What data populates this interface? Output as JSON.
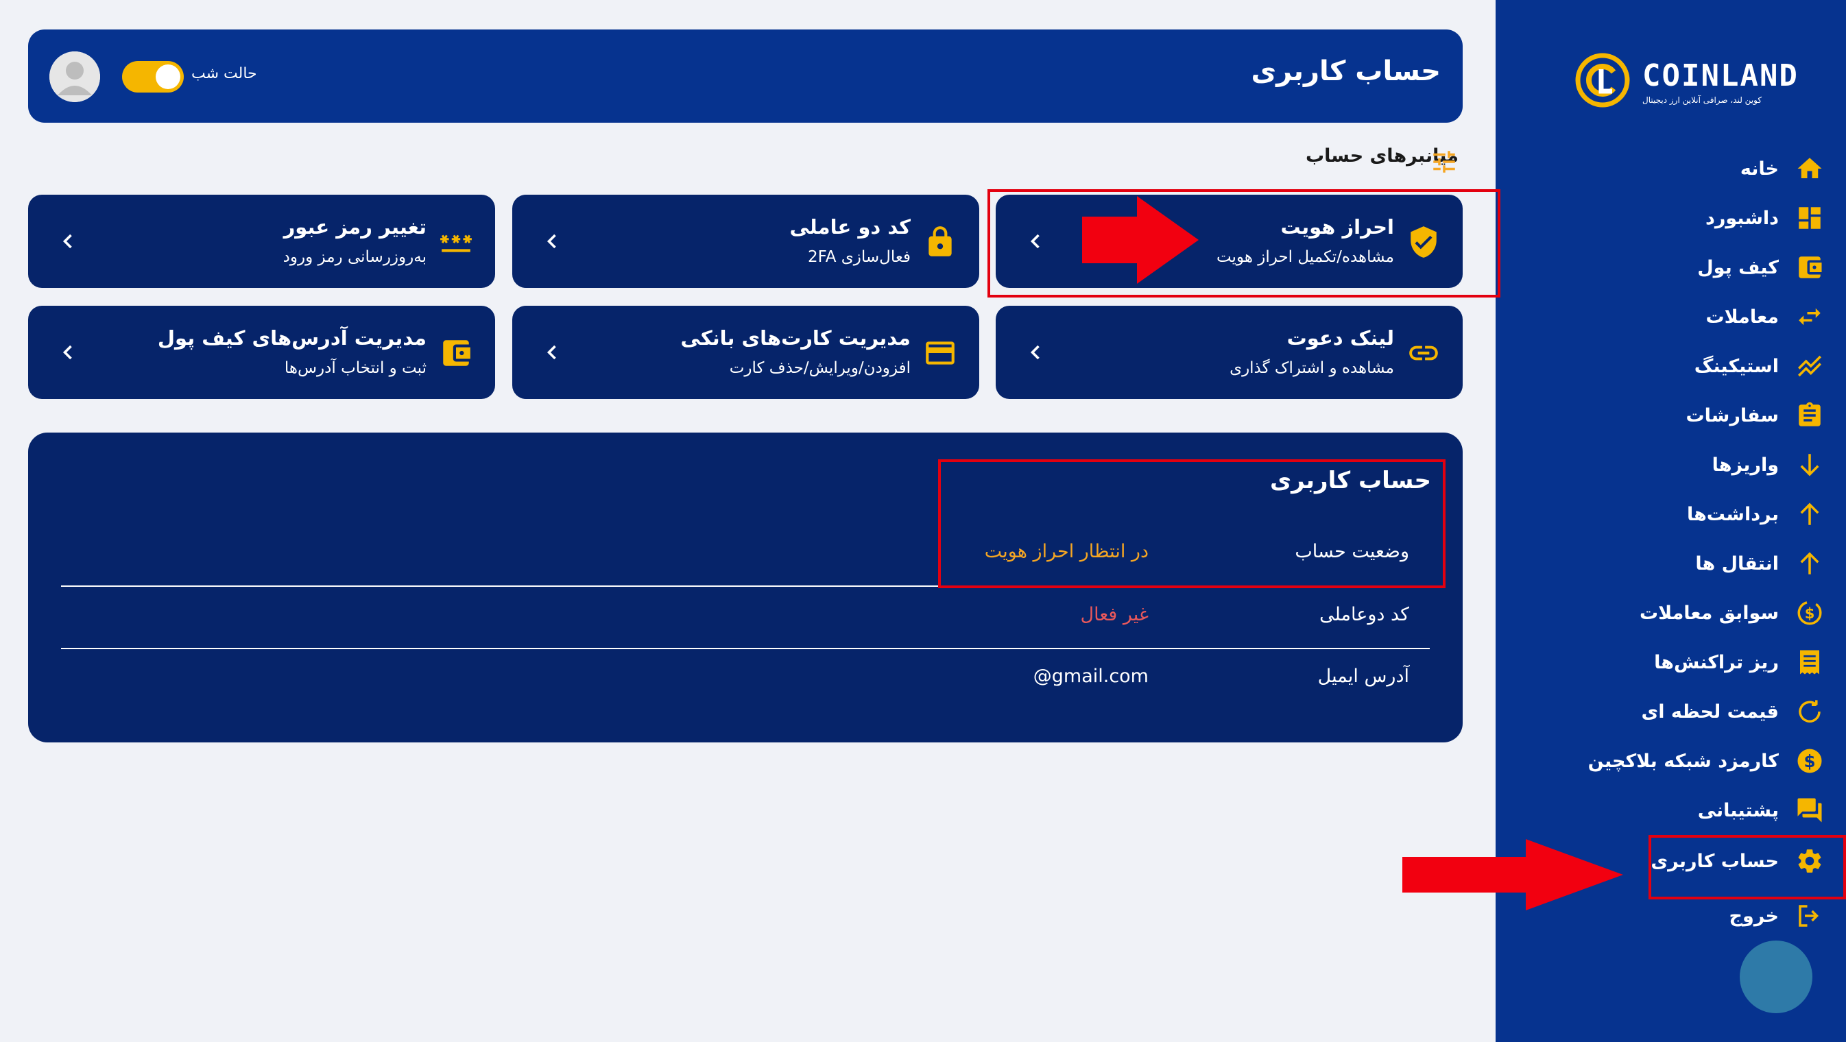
{
  "brand": {
    "name": "COINLAND",
    "tagline": "کوین لند، صرافی آنلاین ارز دیجیتال"
  },
  "sidebar": {
    "items": [
      {
        "label": "خانه",
        "icon": "home-icon"
      },
      {
        "label": "داشبورد",
        "icon": "dashboard-icon"
      },
      {
        "label": "کیف پول",
        "icon": "wallet-icon"
      },
      {
        "label": "معاملات",
        "icon": "swap-icon"
      },
      {
        "label": "استیکینگ",
        "icon": "staking-icon"
      },
      {
        "label": "سفارشات",
        "icon": "clipboard-icon"
      },
      {
        "label": "واریزها",
        "icon": "arrow-down-icon"
      },
      {
        "label": "برداشت‌ها",
        "icon": "arrow-up-icon"
      },
      {
        "label": "انتقال ها",
        "icon": "arrow-up-icon"
      },
      {
        "label": "سوابق معاملات",
        "icon": "dollar-history-icon"
      },
      {
        "label": "ریز تراکنش‌ها",
        "icon": "receipt-icon"
      },
      {
        "label": "قیمت لحظه ای",
        "icon": "refresh-icon"
      },
      {
        "label": "کارمزد شبکه بلاکچین",
        "icon": "dollar-coin-icon"
      },
      {
        "label": "پشتیبانی",
        "icon": "chat-icon"
      },
      {
        "label": "حساب کاربری",
        "icon": "gear-icon"
      },
      {
        "label": "خروج",
        "icon": "logout-icon"
      }
    ]
  },
  "header": {
    "title": "حساب کاربری",
    "night_mode_label": "حالت شب"
  },
  "shortcuts": {
    "title": "میانبرهای حساب",
    "cards": [
      {
        "title": "احراز هویت",
        "subtitle": "مشاهده/تکمیل احراز هویت",
        "icon": "shield-check-icon"
      },
      {
        "title": "کد دو عاملی",
        "subtitle": "فعال‌سازی 2FA",
        "icon": "lock-icon"
      },
      {
        "title": "تغییر رمز عبور",
        "subtitle": "به‌روزرسانی رمز ورود",
        "icon": "password-icon"
      },
      {
        "title": "لینک دعوت",
        "subtitle": "مشاهده و اشتراک گذاری",
        "icon": "link-icon"
      },
      {
        "title": "مدیریت کارت‌های بانکی",
        "subtitle": "افزودن/ویرایش/حذف کارت",
        "icon": "credit-card-icon"
      },
      {
        "title": "مدیریت آدرس‌های کیف پول",
        "subtitle": "ثبت و انتخاب آدرس‌ها",
        "icon": "wallet-icon"
      }
    ]
  },
  "account": {
    "title": "حساب کاربری",
    "rows": [
      {
        "label": "وضعیت حساب",
        "value": "در انتظار احراز هویت",
        "color": "#f5a623"
      },
      {
        "label": "کد دوعاملی",
        "value": "غیر فعال",
        "color": "#e8585b"
      },
      {
        "label": "آدرس ایمیل",
        "value": "@gmail.com",
        "color": "#ffffff"
      }
    ]
  },
  "colors": {
    "sidebar": "#06338f",
    "card": "#06246a",
    "accent": "#f5b600",
    "annotation": "#e3000f"
  }
}
